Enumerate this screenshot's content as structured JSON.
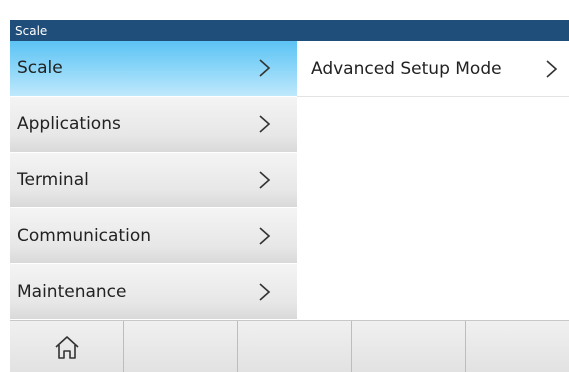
{
  "titlebar": {
    "title": "Scale"
  },
  "menu": {
    "items": [
      {
        "label": "Scale",
        "active": true
      },
      {
        "label": "Applications",
        "active": false
      },
      {
        "label": "Terminal",
        "active": false
      },
      {
        "label": "Communication",
        "active": false
      },
      {
        "label": "Maintenance",
        "active": false
      }
    ]
  },
  "detail": {
    "items": [
      {
        "label": "Advanced Setup Mode"
      }
    ]
  },
  "bottombar": {
    "keys": [
      {
        "icon": "home-icon"
      },
      {
        "icon": ""
      },
      {
        "icon": ""
      },
      {
        "icon": ""
      },
      {
        "icon": ""
      }
    ]
  },
  "colors": {
    "titlebar_bg": "#1f4e7a",
    "active_item": "#86d4f8",
    "inactive_item": "#e7e7e7"
  }
}
